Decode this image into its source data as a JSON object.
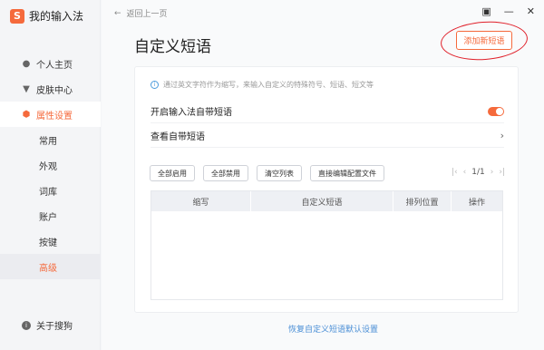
{
  "app": {
    "title": "我的输入法",
    "logo_letter": "S"
  },
  "sidebar": {
    "items": [
      {
        "label": "个人主页",
        "icon": "person-icon"
      },
      {
        "label": "皮肤中心",
        "icon": "shirt-icon"
      },
      {
        "label": "属性设置",
        "icon": "hexagon-gear-icon",
        "active": true
      }
    ],
    "sub_items": [
      {
        "label": "常用"
      },
      {
        "label": "外观"
      },
      {
        "label": "词库"
      },
      {
        "label": "账户"
      },
      {
        "label": "按键"
      },
      {
        "label": "高级",
        "selected": true
      }
    ],
    "about": "关于搜狗"
  },
  "topbar": {
    "back_label": "返回上一页"
  },
  "page": {
    "title": "自定义短语",
    "add_button": "添加新短语",
    "hint": "通过英文字符作为缩写，来输入自定义的特殊符号、短语、短文等",
    "enable_label": "开启输入法自带短语",
    "enable_on": true,
    "view_label": "查看自带短语",
    "buttons": [
      "全部启用",
      "全部禁用",
      "清空列表",
      "直接编辑配置文件"
    ],
    "pager": {
      "text": "1/1"
    },
    "table_headers": [
      "缩写",
      "自定义短语",
      "排列位置",
      "操作"
    ],
    "restore_link": "恢复自定义短语默认设置"
  },
  "colors": {
    "accent": "#f56a3c",
    "link": "#4b8fd6",
    "annotation": "#e0202a"
  }
}
